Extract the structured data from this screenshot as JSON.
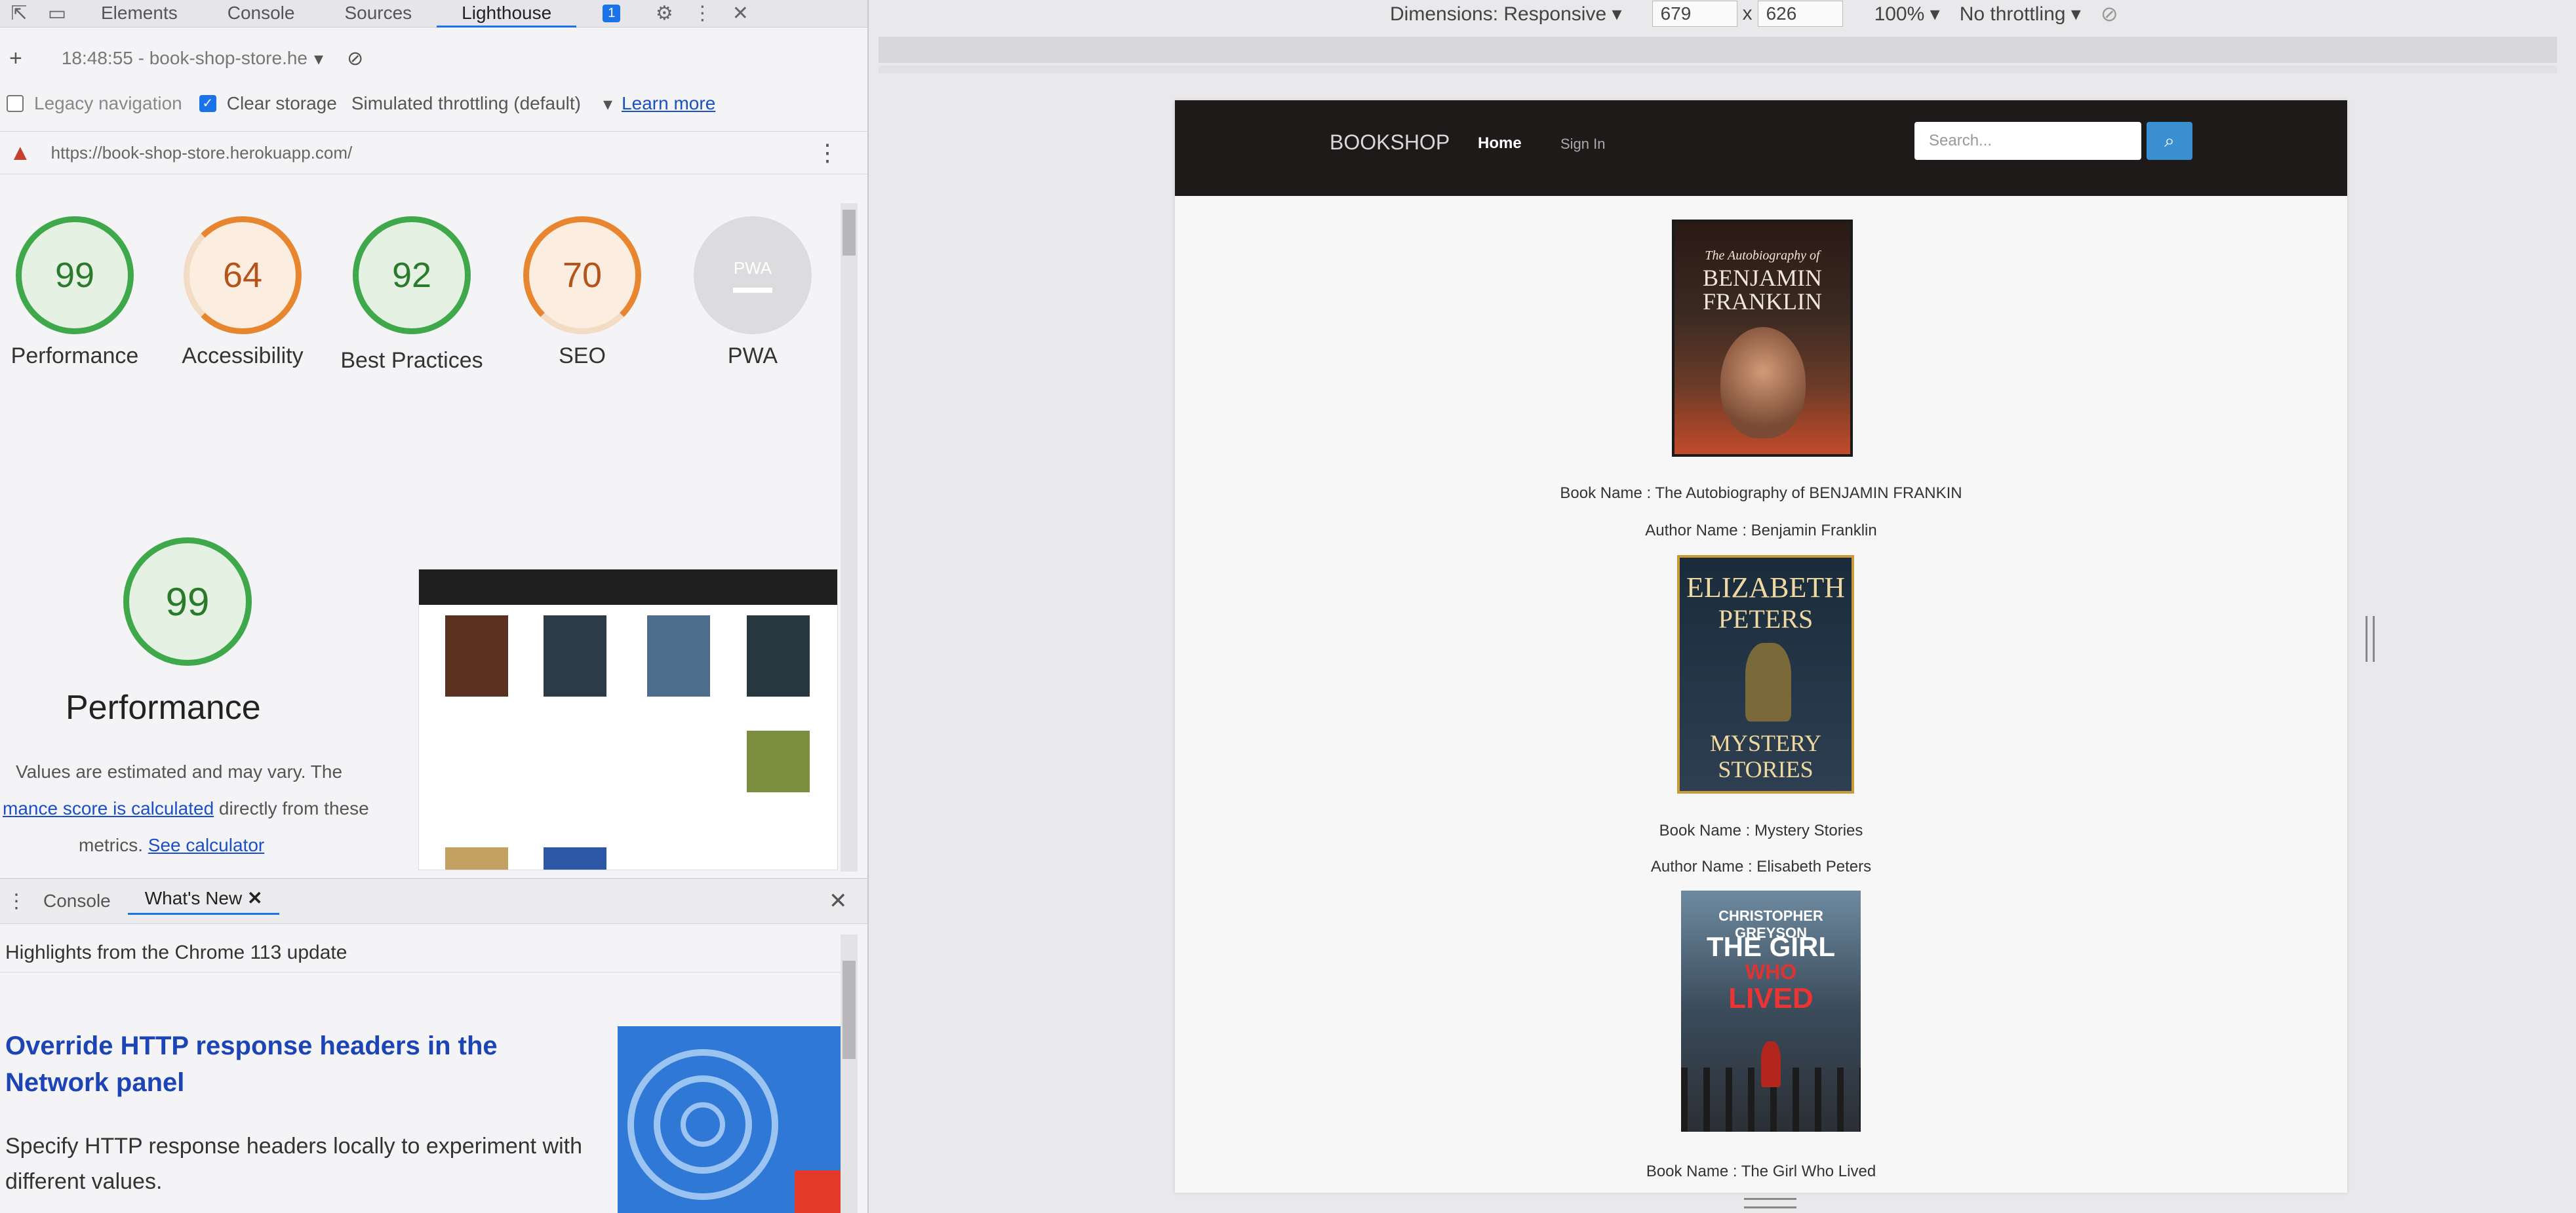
{
  "devtools": {
    "tabs": [
      "Elements",
      "Console",
      "Sources",
      "Lighthouse"
    ],
    "active_tab": "Lighthouse",
    "issues_count": "1",
    "report_selector": "18:48:55 - book-shop-store.he",
    "legacy_navigation": "Legacy navigation",
    "clear_storage": "Clear storage",
    "throttling": "Simulated throttling (default)",
    "learn_more": "Learn more",
    "url": "https://book-shop-store.herokuapp.com/",
    "scores": [
      {
        "label": "Performance",
        "value": "99",
        "color": "#3ea84a",
        "fraction": 0.99
      },
      {
        "label": "Accessibility",
        "value": "64",
        "color": "#e8862f",
        "fraction": 0.64
      },
      {
        "label": "Best Practices",
        "value": "92",
        "color": "#3ea84a",
        "fraction": 0.92
      },
      {
        "label": "SEO",
        "value": "70",
        "color": "#e8862f",
        "fraction": 0.7
      },
      {
        "label": "PWA",
        "value": "PWA",
        "color": "#aaaaaa",
        "fraction": 0
      }
    ],
    "perf_score": "99",
    "perf_label": "Performance",
    "perf_note_1": "Values are estimated and may vary. The",
    "perf_note_2_link": "mance score is calculated",
    "perf_note_2_rest": " directly from these",
    "perf_note_3": "metrics.",
    "perf_note_3_link": "See calculator",
    "drawer_tabs": [
      "Console",
      "What's New"
    ],
    "drawer_active": "What's New",
    "whats_new_heading": "Highlights from the Chrome 113 update",
    "whats_new_title": "Override HTTP response headers in the Network panel",
    "whats_new_desc": "Specify HTTP response headers locally to experiment with different values."
  },
  "device_toolbar": {
    "dimensions_label": "Dimensions: Responsive",
    "width": "679",
    "times": "x",
    "height": "626",
    "zoom": "100%",
    "throttle": "No throttling"
  },
  "site": {
    "brand": "BOOKSHOP",
    "nav_home": "Home",
    "nav_signin": "Sign In",
    "search_placeholder": "Search...",
    "books": [
      {
        "name": "Book Name : The Autobiography of BENJAMIN FRANKIN",
        "author": "Author Name : Benjamin Franklin",
        "cover_line1": "The Autobiography of",
        "cover_line2": "BENJAMIN",
        "cover_line3": "FRANKLIN"
      },
      {
        "name": "Book Name : Mystery Stories",
        "author": "Author Name : Elisabeth Peters",
        "cover_line1": "ELIZABETH",
        "cover_line2": "PETERS",
        "cover_line3": "MYSTERY",
        "cover_line4": "STORIES"
      },
      {
        "name": "Book Name : The Girl Who Lived",
        "cover_line1": "CHRISTOPHER GREYSON",
        "cover_line2": "THE GIRL",
        "cover_line3": "WHO",
        "cover_line4": "LIVED"
      }
    ]
  }
}
